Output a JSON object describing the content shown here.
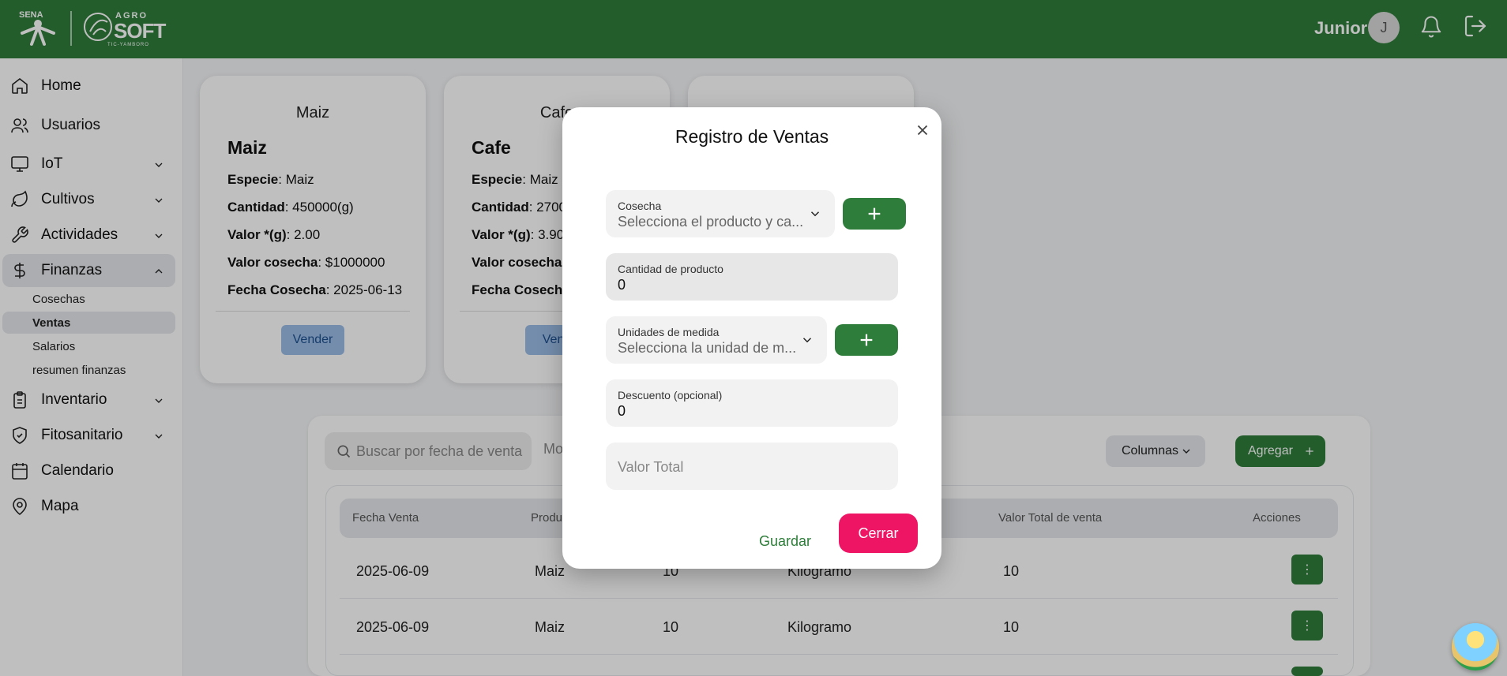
{
  "header": {
    "sena_logo": "SENA",
    "agro_logo_top": "AGRO",
    "agro_logo_main": "SOFT",
    "agro_logo_sub": "TIC-YAMBORO",
    "user_name": "Junior",
    "avatar_initial": "J"
  },
  "sidebar": {
    "items": [
      {
        "label": "Home",
        "icon": "home-icon"
      },
      {
        "label": "Usuarios",
        "icon": "users-icon"
      },
      {
        "label": "IoT",
        "icon": "monitor-icon"
      },
      {
        "label": "Cultivos",
        "icon": "leaf-icon"
      },
      {
        "label": "Actividades",
        "icon": "wrench-icon"
      },
      {
        "label": "Finanzas",
        "icon": "dollar-icon"
      },
      {
        "label": "Inventario",
        "icon": "clipboard-icon"
      },
      {
        "label": "Fitosanitario",
        "icon": "shield-icon"
      },
      {
        "label": "Calendario",
        "icon": "calendar-icon"
      },
      {
        "label": "Mapa",
        "icon": "map-pin-icon"
      }
    ],
    "finanzas_sub": [
      "Cosechas",
      "Ventas",
      "Salarios",
      "resumen finanzas"
    ]
  },
  "cards": [
    {
      "img_alt": "Maiz",
      "name": "Maiz",
      "especie_label": "Especie",
      "especie": ": Maiz",
      "cantidad_label": "Cantidad",
      "cantidad": ": 450000(g)",
      "valor_label": "Valor *(g)",
      "valor": ": 2.00",
      "valor_cosecha_label": "Valor cosecha",
      "valor_cosecha": ": $1000000",
      "fecha_label": "Fecha Cosecha",
      "fecha": ": 2025-06-13",
      "button": "Vender"
    },
    {
      "img_alt": "Cafe",
      "name": "Cafe",
      "especie_label": "Especie",
      "especie": ": Maiz",
      "cantidad_label": "Cantidad",
      "cantidad": ": 2700",
      "valor_label": "Valor *(g)",
      "valor": ": 3.90",
      "valor_cosecha_label": "Valor cosecha",
      "valor_cosecha": ":",
      "fecha_label": "Fecha Cosecha",
      "fecha": ":",
      "button": "Vend"
    }
  ],
  "table": {
    "search_placeholder": "Buscar por fecha de venta",
    "peek_text": "Mo",
    "columns_button": "Columnas",
    "add_button": "Agregar",
    "headers": [
      "Fecha Venta",
      "Produ",
      "Valor Total de venta",
      "Acciones"
    ],
    "rows": [
      {
        "fecha": "2025-06-09",
        "producto": "Maiz",
        "cantidad": "10",
        "unidad": "Kilogramo",
        "total": "10"
      },
      {
        "fecha": "2025-06-09",
        "producto": "Maiz",
        "cantidad": "10",
        "unidad": "Kilogramo",
        "total": "10"
      }
    ],
    "action_glyph": "⋮"
  },
  "modal": {
    "title": "Registro de Ventas",
    "cosecha_label": "Cosecha",
    "cosecha_placeholder": "Selecciona el producto y ca...",
    "cantidad_label": "Cantidad de producto",
    "cantidad_value": "0",
    "unidades_label": "Unidades de medida",
    "unidades_placeholder": "Selecciona la unidad de m...",
    "descuento_label": "Descuento (opcional)",
    "descuento_value": "0",
    "valor_total_placeholder": "Valor Total",
    "save_button": "Guardar",
    "close_button": "Cerrar"
  },
  "colors": {
    "brand_green": "#2e7d3a",
    "danger_pink": "#ee1565",
    "sell_blue": "#9bbde6"
  }
}
